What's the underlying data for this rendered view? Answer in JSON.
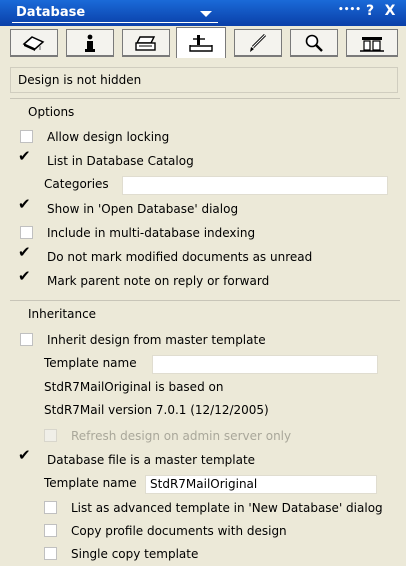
{
  "titlebar": {
    "title": "Database",
    "more_label": "••••",
    "help_label": "?",
    "close_label": "X"
  },
  "tabs": [
    {
      "icon": "eraser-icon",
      "active": false
    },
    {
      "icon": "info-icon",
      "active": false
    },
    {
      "icon": "printer-icon",
      "active": false
    },
    {
      "icon": "design-icon",
      "active": true
    },
    {
      "icon": "pen-icon",
      "active": false
    },
    {
      "icon": "magnifier-icon",
      "active": false
    },
    {
      "icon": "advanced-icon",
      "active": false
    }
  ],
  "status": {
    "text": "Design is not hidden"
  },
  "options": {
    "title": "Options",
    "allow_locking": {
      "label": "Allow design locking",
      "checked": false
    },
    "list_catalog": {
      "label": "List in Database Catalog",
      "checked": true
    },
    "categories_label": "Categories",
    "categories_value": "",
    "show_open": {
      "label": "Show in 'Open Database' dialog",
      "checked": true
    },
    "multi_index": {
      "label": "Include in multi-database indexing",
      "checked": false
    },
    "no_unread": {
      "label": "Do not mark modified documents as unread",
      "checked": true
    },
    "mark_parent": {
      "label": "Mark parent note on reply or forward",
      "checked": true
    }
  },
  "inheritance": {
    "title": "Inheritance",
    "inherit": {
      "label": "Inherit design from master template",
      "checked": false
    },
    "template_label_1": "Template name",
    "template_value_1": "",
    "based_on_line1": "StdR7MailOriginal is based on",
    "based_on_line2": "StdR7Mail version 7.0.1 (12/12/2005)",
    "refresh": {
      "label": "Refresh design on admin server only",
      "checked": false,
      "disabled": true
    },
    "master": {
      "label": "Database file is a master template",
      "checked": true
    },
    "template_label_2": "Template name",
    "template_value_2": "StdR7MailOriginal",
    "list_advanced": {
      "label": "List as advanced template in 'New Database' dialog",
      "checked": false
    },
    "copy_profile": {
      "label": "Copy profile documents with design",
      "checked": false
    },
    "single_copy": {
      "label": "Single copy template",
      "checked": false
    }
  },
  "check_mark": "✔",
  "colors": {
    "titlebar": "#0a3fa8",
    "panel": "#ece9d8"
  }
}
